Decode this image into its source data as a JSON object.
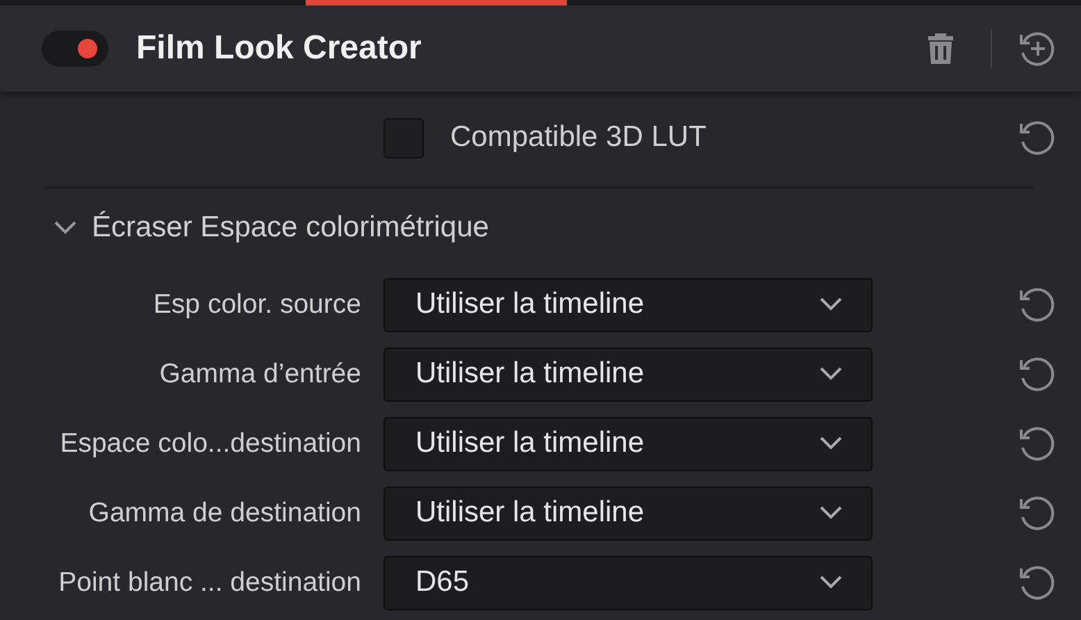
{
  "header": {
    "enabled": true,
    "title": "Film Look Creator"
  },
  "checkbox": {
    "label": "Compatible 3D LUT",
    "checked": false
  },
  "section": {
    "title": "Écraser Espace colorimétrique",
    "expanded": true,
    "rows": [
      {
        "label": "Esp color. source",
        "value": "Utiliser la timeline"
      },
      {
        "label": "Gamma d’entrée",
        "value": "Utiliser la timeline"
      },
      {
        "label": "Espace colo...destination",
        "value": "Utiliser la timeline"
      },
      {
        "label": "Gamma de destination",
        "value": "Utiliser la timeline"
      },
      {
        "label": "Point blanc ... destination",
        "value": "D65"
      }
    ]
  }
}
